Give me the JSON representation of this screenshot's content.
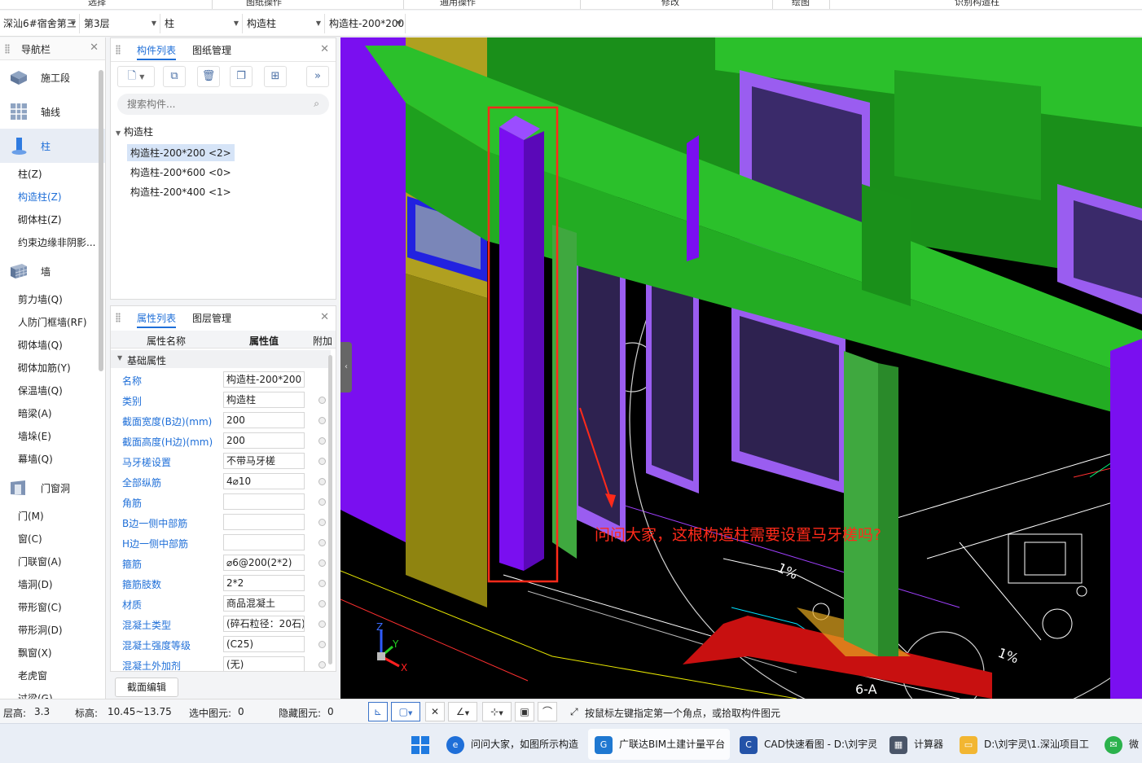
{
  "ribbon": {
    "groups": [
      "选择",
      "图纸操作",
      "通用操作",
      "修改",
      "绘图",
      "识别构造柱"
    ]
  },
  "selectors": {
    "project": "深汕6#宿舍第三",
    "floor": "第3层",
    "category": "柱",
    "type": "构造柱",
    "component": "构造柱-200*200"
  },
  "nav": {
    "title": "导航栏",
    "categories": [
      {
        "label": "施工段",
        "icon": "construction-stage-icon"
      },
      {
        "label": "轴线",
        "icon": "axis-grid-icon"
      },
      {
        "label": "柱",
        "icon": "column-icon"
      },
      {
        "label": "墙",
        "icon": "wall-icon"
      },
      {
        "label": "门窗洞",
        "icon": "door-window-icon"
      }
    ],
    "column_items": [
      "柱(Z)",
      "构造柱(Z)",
      "砌体柱(Z)",
      "约束边缘非阴影..."
    ],
    "wall_items": [
      "剪力墙(Q)",
      "人防门框墙(RF)",
      "砌体墙(Q)",
      "砌体加筋(Y)",
      "保温墙(Q)",
      "暗梁(A)",
      "墙垛(E)",
      "幕墙(Q)"
    ],
    "door_items": [
      "门(M)",
      "窗(C)",
      "门联窗(A)",
      "墙洞(D)",
      "带形窗(C)",
      "带形洞(D)",
      "飘窗(X)",
      "老虎窗",
      "过梁(G)"
    ]
  },
  "component_panel": {
    "tab_list": "构件列表",
    "tab_drawings": "图纸管理",
    "search_placeholder": "搜索构件...",
    "tree_root": "构造柱",
    "items": [
      "构造柱-200*200 <2>",
      "构造柱-200*600 <0>",
      "构造柱-200*400 <1>"
    ]
  },
  "property_panel": {
    "tab_props": "属性列表",
    "tab_layers": "图层管理",
    "col_name": "属性名称",
    "col_value": "属性值",
    "col_extra": "附加",
    "group": "基础属性",
    "rows": [
      {
        "name": "名称",
        "value": "构造柱-200*200"
      },
      {
        "name": "类别",
        "value": "构造柱"
      },
      {
        "name": "截面宽度(B边)(mm)",
        "value": "200"
      },
      {
        "name": "截面高度(H边)(mm)",
        "value": "200"
      },
      {
        "name": "马牙槎设置",
        "value": "不带马牙槎"
      },
      {
        "name": "全部纵筋",
        "value": "4⌀10"
      },
      {
        "name": "角筋",
        "value": ""
      },
      {
        "name": "B边一侧中部筋",
        "value": ""
      },
      {
        "name": "H边一侧中部筋",
        "value": ""
      },
      {
        "name": "箍筋",
        "value": "⌀6@200(2*2)"
      },
      {
        "name": "箍筋肢数",
        "value": "2*2"
      },
      {
        "name": "材质",
        "value": "商品混凝土"
      },
      {
        "name": "混凝土类型",
        "value": "(碎石粒径：20石)"
      },
      {
        "name": "混凝土强度等级",
        "value": "(C25)"
      },
      {
        "name": "混凝土外加剂",
        "value": "(无)"
      }
    ],
    "section_edit": "截面编辑"
  },
  "viewport": {
    "question": "问问大家，这根构造柱需要设置马牙槎吗?",
    "label_axis": "6-A",
    "label_slope1": "1%",
    "label_slope2": "1%",
    "axis_x": "X",
    "axis_y": "Y",
    "axis_z": "Z",
    "colors": {
      "beam_green": "#22b322",
      "column_purple": "#7a0ff0",
      "wall_olive": "#8f8410",
      "highlight_red": "#ff2a1a"
    }
  },
  "status": {
    "floor_height_label": "层高:",
    "floor_height": "3.3",
    "elevation_label": "标高:",
    "elevation": "10.45~13.75",
    "selected_label": "选中图元:",
    "selected": "0",
    "hidden_label": "隐藏图元:",
    "hidden": "0",
    "hint": "按鼠标左键指定第一个角点，或拾取构件图元"
  },
  "taskbar": {
    "items": [
      {
        "label": "问问大家，如图所示构造",
        "icon": "edge-browser-icon"
      },
      {
        "label": "广联达BIM土建计量平台",
        "icon": "glodon-app-icon"
      },
      {
        "label": "CAD快速看图 - D:\\刘宇灵",
        "icon": "cad-viewer-icon"
      },
      {
        "label": "计算器",
        "icon": "calculator-icon"
      },
      {
        "label": "D:\\刘宇灵\\1.深汕项目工",
        "icon": "folder-icon"
      },
      {
        "label": "微",
        "icon": "wechat-icon"
      }
    ]
  }
}
